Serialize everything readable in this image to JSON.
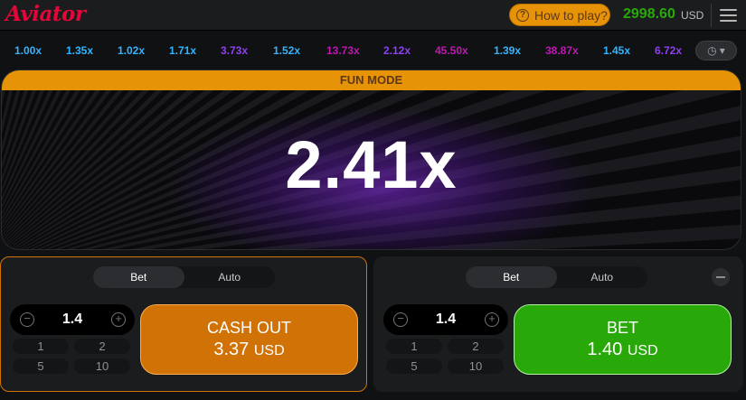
{
  "header": {
    "logo": "Aviator",
    "howto_label": "How to play?",
    "balance": "2998.60",
    "currency": "USD"
  },
  "history": [
    {
      "value": "1.00x",
      "color": "#34b4ff"
    },
    {
      "value": "1.35x",
      "color": "#34b4ff"
    },
    {
      "value": "1.02x",
      "color": "#34b4ff"
    },
    {
      "value": "1.71x",
      "color": "#34b4ff"
    },
    {
      "value": "3.73x",
      "color": "#913ef8"
    },
    {
      "value": "1.52x",
      "color": "#34b4ff"
    },
    {
      "value": "13.73x",
      "color": "#c017b4"
    },
    {
      "value": "2.12x",
      "color": "#913ef8"
    },
    {
      "value": "45.50x",
      "color": "#c017b4"
    },
    {
      "value": "1.39x",
      "color": "#34b4ff"
    },
    {
      "value": "38.87x",
      "color": "#c017b4"
    },
    {
      "value": "1.45x",
      "color": "#34b4ff"
    },
    {
      "value": "6.72x",
      "color": "#913ef8"
    }
  ],
  "game": {
    "mode_label": "FUN MODE",
    "multiplier": "2.41x"
  },
  "panels": {
    "left": {
      "tabs": [
        "Bet",
        "Auto"
      ],
      "bet_amount": "1.4",
      "quick_amounts": [
        "1",
        "2",
        "5",
        "10"
      ],
      "action_label": "CASH OUT",
      "action_amount": "3.37",
      "currency": "USD"
    },
    "right": {
      "tabs": [
        "Bet",
        "Auto"
      ],
      "bet_amount": "1.4",
      "quick_amounts": [
        "1",
        "2",
        "5",
        "10"
      ],
      "action_label": "BET",
      "action_amount": "1.40",
      "currency": "USD"
    }
  },
  "colors": {
    "brand_red": "#e50539",
    "accent_orange": "#e69308",
    "balance_green": "#28a909",
    "cashout_orange": "#d07206",
    "bet_green": "#28a909"
  }
}
